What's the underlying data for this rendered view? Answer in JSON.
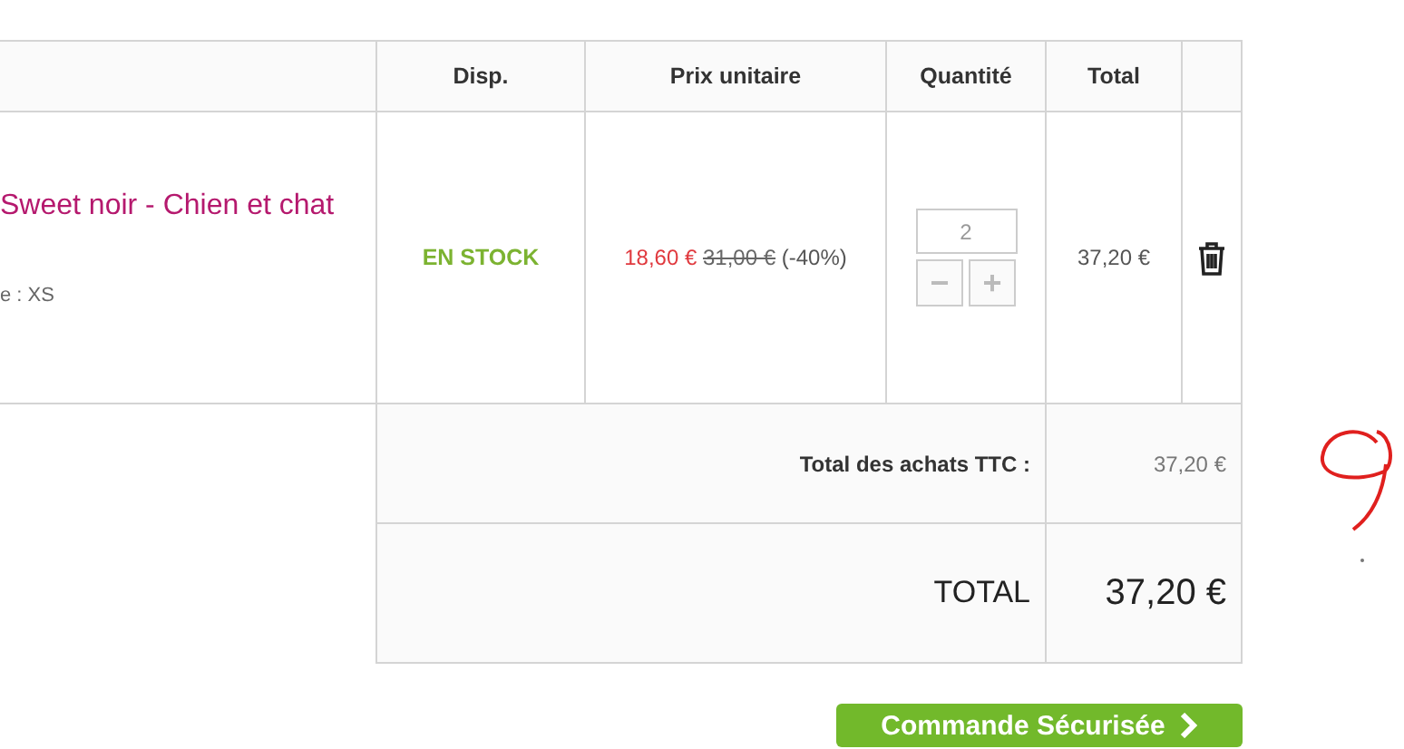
{
  "table": {
    "columns": [
      "Disp.",
      "Prix unitaire",
      "Quantité",
      "Total"
    ],
    "items": [
      {
        "name": "Sweet noir - Chien et chat",
        "option": "e : XS",
        "availability": "EN STOCK",
        "price": "18,60 €",
        "old_price": "31,00 €",
        "discount": "(-40%)",
        "quantity": "2",
        "minus": "−",
        "plus": "+",
        "total": "37,20 €"
      }
    ],
    "summary": [
      {
        "kind": "subtotal",
        "label": "Total des achats TTC :",
        "value": "37,20 €"
      },
      {
        "kind": "grand",
        "label": "TOTAL",
        "value": "37,20 €"
      }
    ]
  },
  "checkout_button": {
    "label": "Commande Sécurisée"
  }
}
